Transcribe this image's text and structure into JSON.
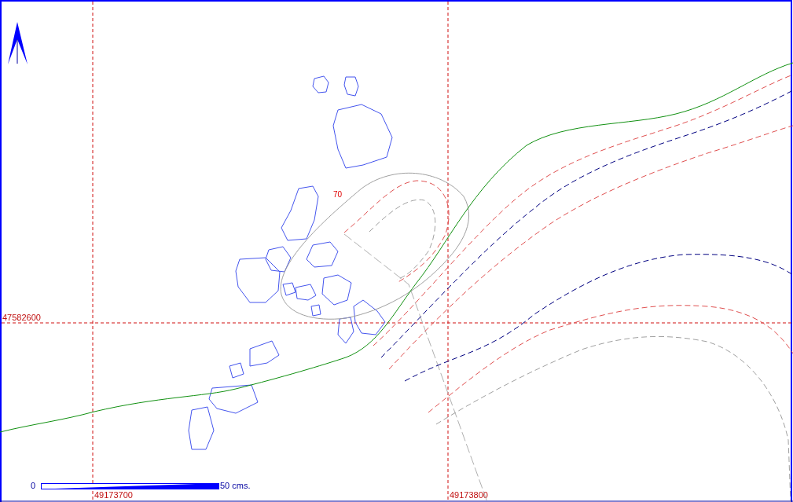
{
  "map": {
    "feature_label": "70",
    "grid": {
      "y_labels": [
        "47582600"
      ],
      "x_labels": [
        "49173700",
        "49173800"
      ]
    },
    "scale_bar": {
      "start": "0",
      "end": "50 cms."
    }
  }
}
